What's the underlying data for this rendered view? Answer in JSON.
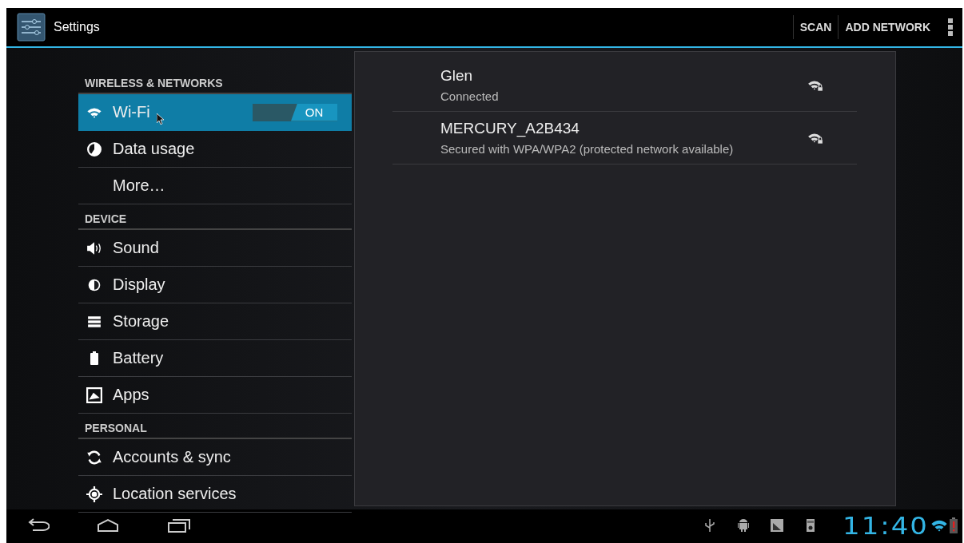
{
  "action_bar": {
    "title": "Settings",
    "actions": [
      "SCAN",
      "ADD NETWORK"
    ]
  },
  "sidebar": [
    {
      "kind": "header",
      "label": "WIRELESS & NETWORKS"
    },
    {
      "kind": "item",
      "label": "Wi-Fi",
      "selected": true,
      "toggle": {
        "label": "ON",
        "on": true
      }
    },
    {
      "kind": "item",
      "label": "Data usage",
      "selected": false
    },
    {
      "kind": "item",
      "label": "More…",
      "selected": false
    },
    {
      "kind": "header",
      "label": "DEVICE"
    },
    {
      "kind": "item",
      "label": "Sound",
      "selected": false
    },
    {
      "kind": "item",
      "label": "Display",
      "selected": false
    },
    {
      "kind": "item",
      "label": "Storage",
      "selected": false
    },
    {
      "kind": "item",
      "label": "Battery",
      "selected": false
    },
    {
      "kind": "item",
      "label": "Apps",
      "selected": false
    },
    {
      "kind": "header",
      "label": "PERSONAL"
    },
    {
      "kind": "item",
      "label": "Accounts & sync",
      "selected": false
    },
    {
      "kind": "item",
      "label": "Location services",
      "selected": false
    }
  ],
  "networks": [
    {
      "name": "Glen",
      "status": "Connected"
    },
    {
      "name": "MERCURY_A2B434",
      "status": "Secured with WPA/WPA2 (protected network available)"
    }
  ],
  "system_bar": {
    "time": "11:40"
  }
}
